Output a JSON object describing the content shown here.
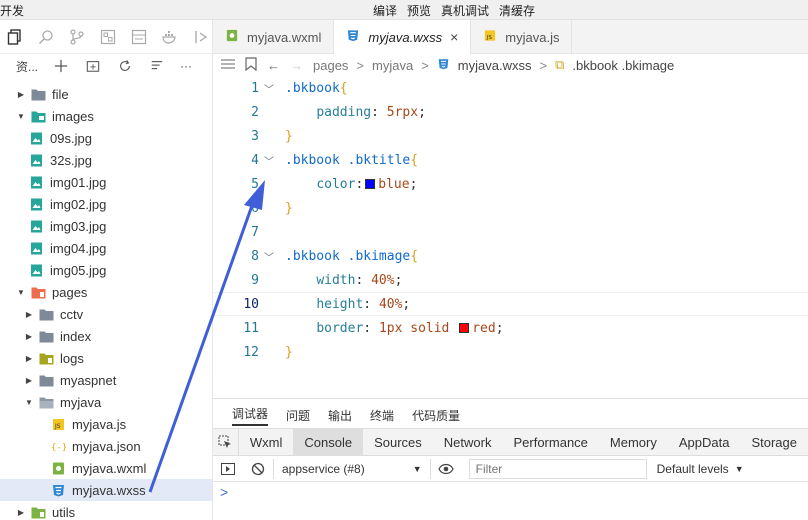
{
  "menubar": {
    "app_fragment": "开发",
    "items": [
      "编译",
      "预览",
      "真机调试",
      "清缓存"
    ]
  },
  "explorer": {
    "header_label": "资...",
    "more": "···",
    "tree": [
      {
        "label": "file",
        "type": "folder",
        "depth": 1,
        "expanded": false
      },
      {
        "label": "images",
        "type": "folder-img",
        "depth": 1,
        "expanded": true
      },
      {
        "label": "09s.jpg",
        "type": "image",
        "depth": 2
      },
      {
        "label": "32s.jpg",
        "type": "image",
        "depth": 2
      },
      {
        "label": "img01.jpg",
        "type": "image",
        "depth": 2
      },
      {
        "label": "img02.jpg",
        "type": "image",
        "depth": 2
      },
      {
        "label": "img03.jpg",
        "type": "image",
        "depth": 2
      },
      {
        "label": "img04.jpg",
        "type": "image",
        "depth": 2
      },
      {
        "label": "img05.jpg",
        "type": "image",
        "depth": 2
      },
      {
        "label": "pages",
        "type": "folder-pages",
        "depth": 1,
        "expanded": true
      },
      {
        "label": "cctv",
        "type": "folder",
        "depth": 2,
        "expanded": false
      },
      {
        "label": "index",
        "type": "folder",
        "depth": 2,
        "expanded": false
      },
      {
        "label": "logs",
        "type": "folder-logs",
        "depth": 2,
        "expanded": false
      },
      {
        "label": "myaspnet",
        "type": "folder",
        "depth": 2,
        "expanded": false
      },
      {
        "label": "myjava",
        "type": "folder-open",
        "depth": 2,
        "expanded": true
      },
      {
        "label": "myjava.js",
        "type": "js",
        "depth": 3
      },
      {
        "label": "myjava.json",
        "type": "json",
        "depth": 3
      },
      {
        "label": "myjava.wxml",
        "type": "wxml",
        "depth": 3
      },
      {
        "label": "myjava.wxss",
        "type": "wxss",
        "depth": 3,
        "selected": true
      },
      {
        "label": "utils",
        "type": "folder-utils",
        "depth": 1,
        "expanded": false
      }
    ]
  },
  "tabs": [
    {
      "label": "myjava.wxml",
      "icon": "wxml",
      "active": false
    },
    {
      "label": "myjava.wxss",
      "icon": "wxss",
      "active": true
    },
    {
      "label": "myjava.js",
      "icon": "js",
      "active": false
    }
  ],
  "tab_close": "×",
  "breadcrumb": {
    "parts": [
      "pages",
      "myjava",
      "myjava.wxss",
      ".bkbook .bkimage"
    ],
    "separator": ">"
  },
  "code": [
    {
      "n": "1",
      "fold": true,
      "tokens": [
        [
          "sel",
          ".bkbook"
        ],
        [
          "brace",
          "{"
        ]
      ]
    },
    {
      "n": "2",
      "tokens": [
        [
          "pad",
          "    "
        ],
        [
          "prop",
          "padding"
        ],
        [
          "punc",
          ": "
        ],
        [
          "val",
          "5rpx"
        ],
        [
          "punc",
          ";"
        ]
      ]
    },
    {
      "n": "3",
      "tokens": [
        [
          "brace",
          "}"
        ]
      ]
    },
    {
      "n": "4",
      "fold": true,
      "tokens": [
        [
          "sel",
          ".bkbook .bktitle"
        ],
        [
          "brace",
          "{"
        ]
      ]
    },
    {
      "n": "5",
      "tokens": [
        [
          "pad",
          "    "
        ],
        [
          "prop",
          "color"
        ],
        [
          "punc",
          ":"
        ],
        [
          "swatch",
          "#0000ff"
        ],
        [
          "val",
          "blue"
        ],
        [
          "punc",
          ";"
        ]
      ]
    },
    {
      "n": "6",
      "tokens": [
        [
          "brace",
          "}"
        ]
      ]
    },
    {
      "n": "7",
      "tokens": []
    },
    {
      "n": "8",
      "fold": true,
      "tokens": [
        [
          "sel",
          ".bkbook .bkimage"
        ],
        [
          "brace",
          "{"
        ]
      ]
    },
    {
      "n": "9",
      "tokens": [
        [
          "pad",
          "    "
        ],
        [
          "prop",
          "width"
        ],
        [
          "punc",
          ": "
        ],
        [
          "val",
          "40%"
        ],
        [
          "punc",
          ";"
        ]
      ]
    },
    {
      "n": "10",
      "highlight": true,
      "tokens": [
        [
          "pad",
          "    "
        ],
        [
          "prop",
          "height"
        ],
        [
          "punc",
          ": "
        ],
        [
          "val",
          "40%"
        ],
        [
          "punc",
          ";"
        ]
      ]
    },
    {
      "n": "11",
      "tokens": [
        [
          "pad",
          "    "
        ],
        [
          "prop",
          "border"
        ],
        [
          "punc",
          ": "
        ],
        [
          "val",
          "1px solid "
        ],
        [
          "swatch",
          "#ff0000"
        ],
        [
          "val",
          "red"
        ],
        [
          "punc",
          ";"
        ]
      ]
    },
    {
      "n": "12",
      "tokens": [
        [
          "brace",
          "}"
        ]
      ]
    }
  ],
  "devtools": {
    "top_tabs": [
      "调试器",
      "问题",
      "输出",
      "终端",
      "代码质量"
    ],
    "panel_tabs": [
      "Wxml",
      "Console",
      "Sources",
      "Network",
      "Performance",
      "Memory",
      "AppData",
      "Storage"
    ],
    "active_panel": "Console",
    "context": "appservice (#8)",
    "filter_placeholder": "Filter",
    "levels": "Default levels",
    "prompt": ">"
  },
  "colors": {
    "selector": "#116acd",
    "property": "#267f99",
    "value": "#a8481b",
    "brace": "#d8a01a",
    "line_number": "#237893",
    "arrow": "#3f5ed8",
    "selection_bg": "#e4e9f7"
  }
}
